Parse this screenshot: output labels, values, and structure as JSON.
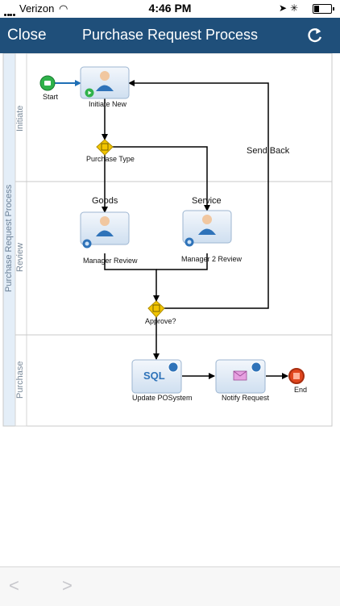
{
  "status": {
    "carrier": "Verizon",
    "time": "4:46 PM",
    "icons": [
      "signal-icon",
      "wifi-icon",
      "location-icon",
      "bluetooth-icon",
      "battery-icon"
    ]
  },
  "nav": {
    "close_label": "Close",
    "title": "Purchase Request Process",
    "refresh_icon": "refresh-icon",
    "bar_color": "#1f4f7a"
  },
  "diagram": {
    "pool_label": "Purchase Request Process",
    "lanes": [
      "Initiate",
      "Review",
      "Purchase"
    ],
    "nodes": {
      "start": "Start",
      "initiate_new": "Initiate New",
      "purchase_type": "Purchase Type",
      "manager_review": "Manager Review",
      "manager2_review": "Manager 2 Review",
      "approve": "Approve?",
      "update_po": "Update POSystem",
      "sql_label": "SQL",
      "notify": "Notify Request",
      "end": "End"
    },
    "edges": {
      "goods": "Goods",
      "service": "Service",
      "send_back": "Send Back"
    },
    "colors": {
      "task_fill": "#dfeaf7",
      "gateway": "#f2c500",
      "start": "#2fb24a",
      "end": "#e0461e",
      "lane_tint": "#e4eef8"
    }
  },
  "bottom": {
    "back_icon": "back-arrow-icon",
    "forward_icon": "forward-arrow-icon"
  }
}
